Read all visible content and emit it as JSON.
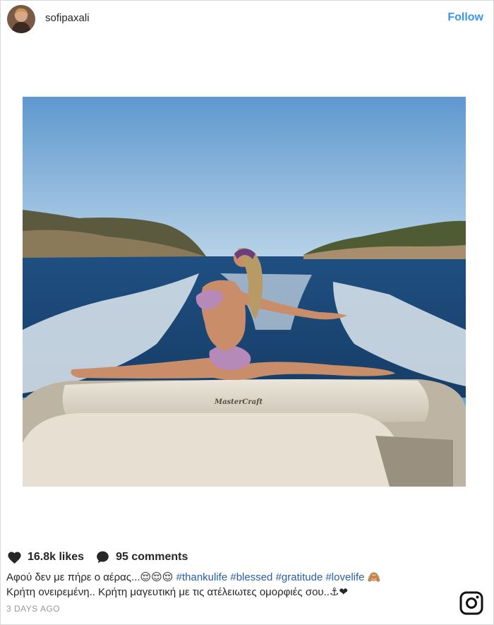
{
  "post": {
    "username": "sofipaxali",
    "follow_label": "Follow",
    "likes": "16.8k likes",
    "comments": "95 comments",
    "caption_line1_text": "Αφού δεν με πήρε ο αέρας...😌😌😌",
    "hashtags": [
      "#thankulife",
      "#blessed",
      "#gratitude",
      "#lovelife"
    ],
    "caption_line1_end": "🙈",
    "caption_line2": "Κρήτη ονειρεμένη.. Κρήτη μαγευτική με τις ατέλειωτες ομορφιές σου..⚓❤",
    "timestamp": "3 DAYS AGO",
    "boat_brand": "MasterCraft"
  },
  "icons": {
    "like": "heart-icon",
    "comment": "comment-icon",
    "logo": "instagram-logo-icon"
  },
  "colors": {
    "follow": "#3897f0",
    "hashtag": "#2a5da8",
    "timestamp": "#999999",
    "text": "#262626"
  }
}
